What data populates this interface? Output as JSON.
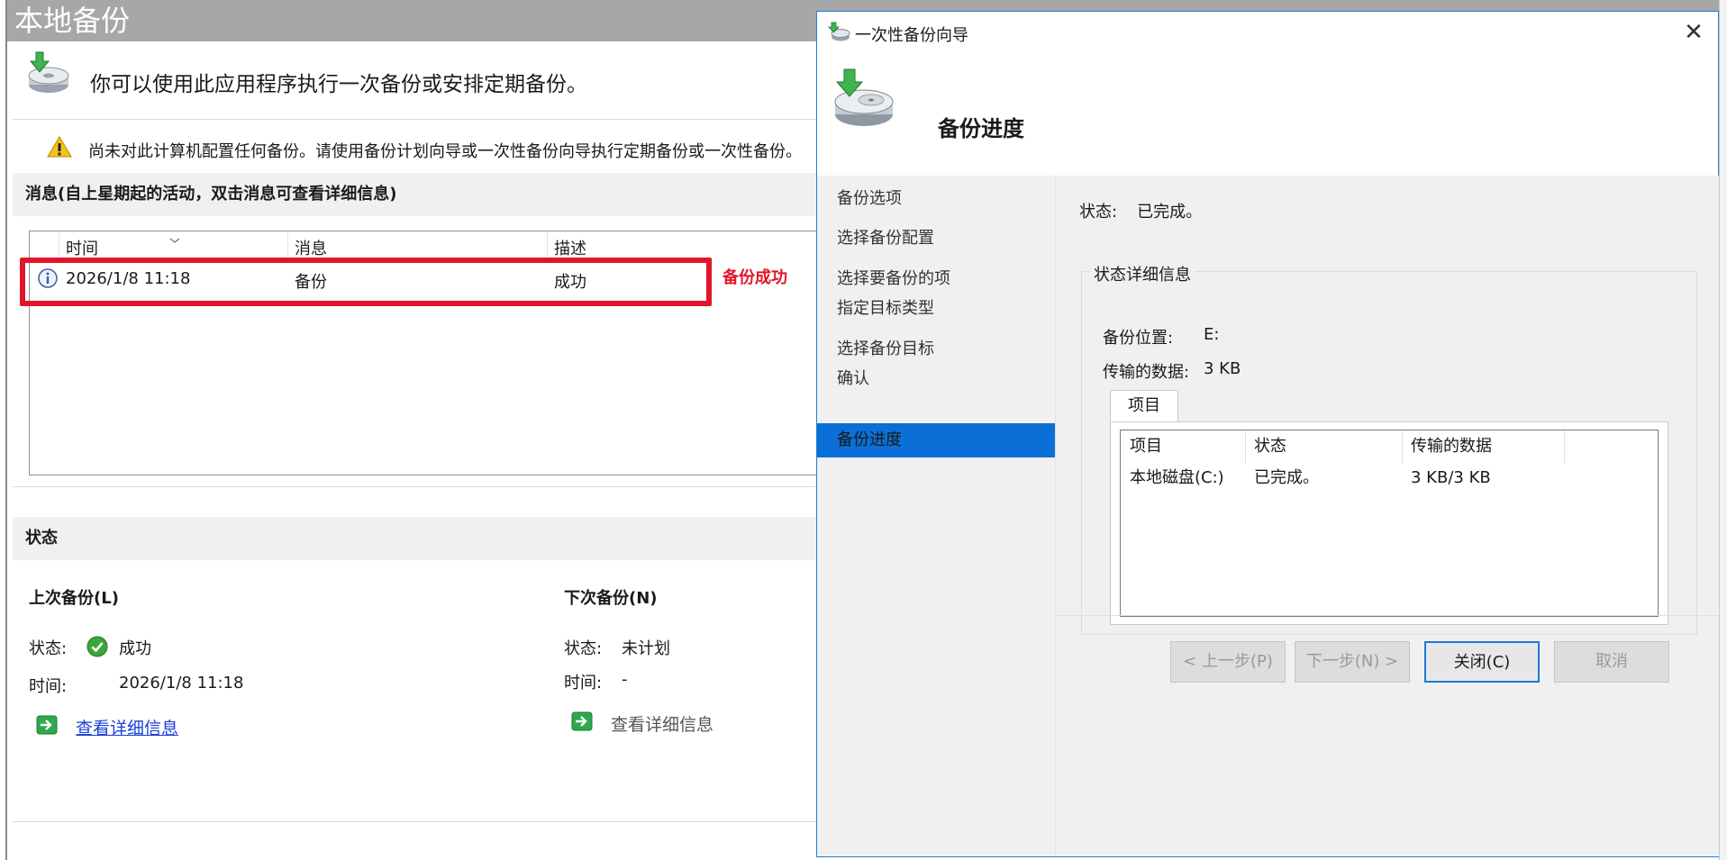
{
  "background_window": {
    "title": "本地备份",
    "intro_text": "你可以使用此应用程序执行一次备份或安排定期备份。",
    "warning_text": "尚未对此计算机配置任何备份。请使用备份计划向导或一次性备份向导执行定期备份或一次性备份。",
    "messages_section": {
      "title": "消息(自上星期起的活动，双击消息可查看详细信息)",
      "columns": [
        "时间",
        "消息",
        "描述"
      ],
      "rows": [
        {
          "time": "2026/1/8 11:18",
          "message": "备份",
          "description": "成功"
        }
      ],
      "annotation": "备份成功"
    },
    "status_section": {
      "title": "状态",
      "last_backup": {
        "title": "上次备份(L)",
        "status_label": "状态:",
        "status_value": "成功",
        "time_label": "时间:",
        "time_value": "2026/1/8 11:18",
        "details_link": "查看详细信息"
      },
      "next_backup": {
        "title": "下次备份(N)",
        "status_label": "状态:",
        "status_value": "未计划",
        "time_label": "时间:",
        "time_value": "-",
        "details_link": "查看详细信息"
      }
    }
  },
  "dialog": {
    "title": "一次性备份向导",
    "close_glyph": "✕",
    "header_title": "备份进度",
    "steps": [
      "备份选项",
      "选择备份配置",
      "选择要备份的项",
      "指定目标类型",
      "选择备份目标",
      "确认",
      "备份进度"
    ],
    "active_step_index": 6,
    "state_label": "状态:",
    "state_value": "已完成。",
    "details_group": {
      "title": "状态详细信息",
      "location_label": "备份位置:",
      "location_value": "E:",
      "transferred_label": "传输的数据:",
      "transferred_value": "3 KB",
      "tab_label": "项目",
      "grid_columns": [
        "项目",
        "状态",
        "传输的数据"
      ],
      "grid_rows": [
        {
          "item": "本地磁盘(C:)",
          "status": "已完成。",
          "data": "3 KB/3 KB"
        }
      ]
    },
    "buttons": {
      "prev": "< 上一步(P)",
      "next": "下一步(N) >",
      "close": "关闭(C)",
      "cancel": "取消"
    }
  },
  "colors": {
    "annotation_red": "#e3152b",
    "accent_blue": "#0a6fd6",
    "link_blue": "#1a3fd6",
    "success_green": "#3aa63a"
  },
  "icons": {
    "backup_app": "backup-disk-icon",
    "warning": "warning-triangle-icon",
    "info": "info-circle-icon",
    "success": "green-check-icon",
    "link_arrow": "green-arrow-icon"
  }
}
